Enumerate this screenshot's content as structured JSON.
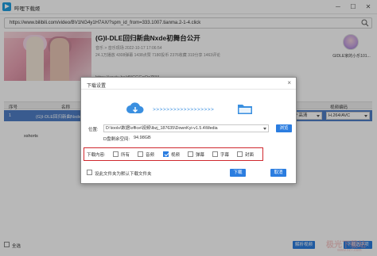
{
  "window": {
    "title": "哔哩下载姬"
  },
  "url": {
    "value": "https://www.bilibili.com/video/BV1NG4y1H7AX/?spm_id_from=333.1007.tianma.2-1-4.click"
  },
  "video": {
    "title": "(G)I-DLE回归新曲Nxde初舞台公开",
    "meta_line1": "音乐 > 音乐现场    2022-10-17 17:06:54",
    "meta_line2": "24.1万播放   4308弹幕   1438点赞   7180投币   2376收藏   319分享   1463评论",
    "link": "https://youtu.be/dNCGGpQzZ5M",
    "uploader": "GIDLE家的小乐101..."
  },
  "table": {
    "headers": [
      "序号",
      "名称",
      "画质",
      "视频编码"
    ],
    "rows": [
      {
        "index": "1",
        "name": "(G)I-DLE回归新曲Nxde初舞台公开",
        "quality": "1080P 高清",
        "codec": "H.264/AVC",
        "selected": true
      },
      {
        "index": "",
        "name": "xshorts",
        "quality": "",
        "codec": "",
        "selected": false
      }
    ]
  },
  "bottom": {
    "select_all": "全选",
    "parse_button": "解析视频",
    "download_button": "下载选中项"
  },
  "watermark": {
    "text": "极光下载站",
    "sub": "www.xz7.com"
  },
  "dialog": {
    "title": "下载设置",
    "close": "×",
    "location_label": "位置:",
    "path": "D:\\tools\\数据\\office\\视频\\lbzj_187635\\DownKyi-v1.5.4\\Media",
    "browse": "浏览",
    "space_label": "D盘剩余空间:",
    "space_value": "94.98GB",
    "content_label": "下载内容:",
    "options": [
      {
        "label": "所有",
        "checked": false
      },
      {
        "label": "音频",
        "checked": false
      },
      {
        "label": "视频",
        "checked": true
      },
      {
        "label": "弹幕",
        "checked": false
      },
      {
        "label": "字幕",
        "checked": false
      },
      {
        "label": "封面",
        "checked": false
      }
    ],
    "default_path_label": "设此文件夹为默认下载文件夹",
    "download_button": "下载",
    "cancel_button": "取消"
  },
  "colors": {
    "accent": "#2b7de0",
    "selected_row": "#4f7fc6",
    "highlight_frame": "#d0282e"
  }
}
